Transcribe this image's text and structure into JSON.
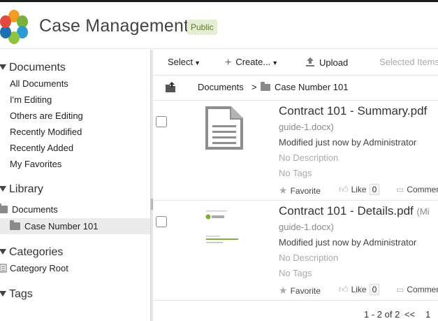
{
  "header": {
    "title": "Case Management",
    "badge": "Public"
  },
  "sidebar": {
    "documents": {
      "heading": "Documents",
      "items": [
        "All Documents",
        "I'm Editing",
        "Others are Editing",
        "Recently Modified",
        "Recently Added",
        "My Favorites"
      ]
    },
    "library": {
      "heading": "Library",
      "root": "Documents",
      "child": "Case Number 101"
    },
    "categories": {
      "heading": "Categories",
      "root": "Category Root"
    },
    "tags": {
      "heading": "Tags"
    }
  },
  "toolbar": {
    "select": "Select",
    "create": "Create...",
    "upload": "Upload",
    "selected_items": "Selected Items"
  },
  "path": {
    "root": "Documents",
    "separator": ">",
    "current": "Case Number 101"
  },
  "documents": [
    {
      "title": "Contract 101 - Summary.pdf",
      "subtitle": "guide-1.docx)",
      "modified": "Modified just now by Administrator",
      "description": "No Description",
      "tags": "No Tags",
      "favorite_label": "Favorite",
      "like_label": "Like",
      "like_count": "0",
      "comment_label": "Comment"
    },
    {
      "title": "Contract 101 - Details.pdf",
      "title_extra": "(Mi",
      "subtitle": "guide-1.docx)",
      "modified": "Modified just now by Administrator",
      "description": "No Description",
      "tags": "No Tags",
      "favorite_label": "Favorite",
      "like_label": "Like",
      "like_count": "0",
      "comment_label": "Comment"
    }
  ],
  "pager": {
    "range": "1 - 2 of 2",
    "prev": "<<",
    "page": "1"
  },
  "colors": {
    "badge_bg": "#e4eed3",
    "badge_text": "#5a7a2a",
    "selected_row": "#ebebeb"
  }
}
